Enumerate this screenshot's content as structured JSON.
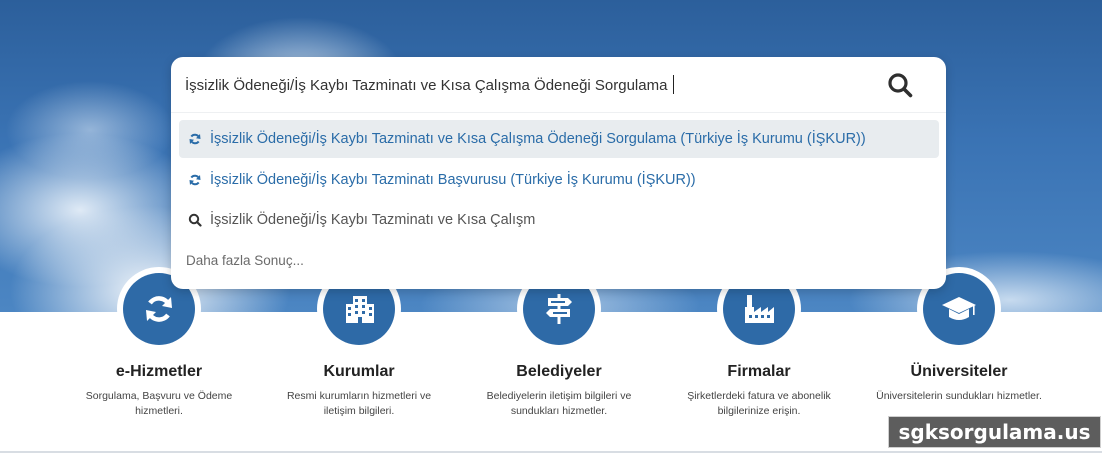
{
  "search": {
    "value": "İşsizlik Ödeneği/İş Kaybı Tazminatı ve Kısa Çalışma Ödeneği Sorgulama",
    "button_icon": "search-icon"
  },
  "suggestions": [
    {
      "text": "İşsizlik Ödeneği/İş Kaybı Tazminatı ve Kısa Çalışma Ödeneği Sorgulama (Türkiye İş Kurumu (İŞKUR))",
      "icon": "refresh-icon",
      "highlighted": true
    },
    {
      "text": "İşsizlik Ödeneği/İş Kaybı Tazminatı Başvurusu (Türkiye İş Kurumu (İŞKUR))",
      "icon": "refresh-icon",
      "highlighted": false
    },
    {
      "text": "İşsizlik Ödeneği/İş Kaybı Tazminatı ve Kısa Çalışm",
      "icon": "search-icon",
      "highlighted": false
    }
  ],
  "more_results": "Daha fazla Sonuç...",
  "categories": [
    {
      "title": "e-Hizmetler",
      "desc": "Sorgulama, Başvuru ve Ödeme hizmetleri.",
      "icon": "refresh-icon"
    },
    {
      "title": "Kurumlar",
      "desc": "Resmi kurumların hizmetleri ve iletişim bilgileri.",
      "icon": "building-icon"
    },
    {
      "title": "Belediyeler",
      "desc": "Belediyelerin iletişim bilgileri ve sundukları hizmetler.",
      "icon": "signpost-icon"
    },
    {
      "title": "Firmalar",
      "desc": "Şirketlerdeki fatura ve abonelik bilgilerinize erişin.",
      "icon": "factory-icon"
    },
    {
      "title": "Üniversiteler",
      "desc": "Üniversitelerin sundukları hizmetler.",
      "icon": "graduation-cap-icon"
    }
  ],
  "watermark": "sgksorgulama.us",
  "colors": {
    "accent": "#2e6aa7",
    "link": "#2a6ca8",
    "sky": "#3a73b4"
  }
}
